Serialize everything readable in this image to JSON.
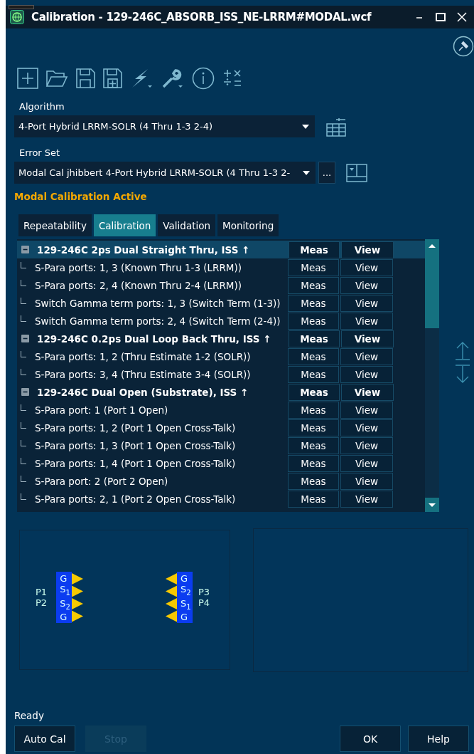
{
  "window": {
    "title": "Calibration - 129-246C_ABSORB_ISS_NE-LRRM#MODAL.wcf"
  },
  "algorithm": {
    "label": "Algorithm",
    "value": "4-Port Hybrid LRRM-SOLR (4 Thru 1-3 2-4)"
  },
  "error_set": {
    "label": "Error Set",
    "value": "Modal Cal jhibbert 4-Port Hybrid LRRM-SOLR (4 Thru 1-3 2-",
    "browse": "..."
  },
  "mode_status": "Modal Calibration Active",
  "tabs": [
    {
      "label": "Repeatability",
      "selected": false
    },
    {
      "label": "Calibration",
      "selected": true
    },
    {
      "label": "Validation",
      "selected": false
    },
    {
      "label": "Monitoring",
      "selected": false
    }
  ],
  "tree": [
    {
      "label": "129-246C 2ps Dual Straight Thru,  ISS ↑",
      "expanded": true,
      "selected": true,
      "meas": "Meas",
      "view": "View",
      "children": [
        {
          "label": "S-Para ports: 1, 3 (Known Thru 1-3 (LRRM))",
          "selected": false,
          "meas": "Meas",
          "view": "View"
        },
        {
          "label": "S-Para ports: 2, 4 (Known Thru 2-4 (LRRM))",
          "selected": false,
          "meas": "Meas",
          "view": "View"
        },
        {
          "label": "Switch Gamma term ports: 1, 3 (Switch Term (1-3))",
          "selected": false,
          "meas": "Meas",
          "view": "View"
        },
        {
          "label": "Switch Gamma term ports: 2, 4 (Switch Term (2-4))",
          "selected": false,
          "meas": "Meas",
          "view": "View"
        }
      ]
    },
    {
      "label": "129-246C 0.2ps Dual Loop Back Thru,  ISS ↑",
      "expanded": true,
      "selected": false,
      "meas": "Meas",
      "view": "View",
      "children": [
        {
          "label": "S-Para ports: 1, 2 (Thru Estimate 1-2 (SOLR))",
          "selected": false,
          "meas": "Meas",
          "view": "View"
        },
        {
          "label": "S-Para ports: 3, 4 (Thru Estimate 3-4 (SOLR))",
          "selected": false,
          "meas": "Meas",
          "view": "View"
        }
      ]
    },
    {
      "label": "129-246C Dual Open (Substrate),  ISS ↑",
      "expanded": true,
      "selected": false,
      "meas": "Meas",
      "view": "View",
      "children": [
        {
          "label": "S-Para port: 1 (Port 1 Open)",
          "selected": false,
          "meas": "Meas",
          "view": "View"
        },
        {
          "label": "S-Para ports: 1, 2 (Port 1 Open Cross-Talk)",
          "selected": false,
          "meas": "Meas",
          "view": "View"
        },
        {
          "label": "S-Para ports: 1, 3 (Port 1 Open Cross-Talk)",
          "selected": false,
          "meas": "Meas",
          "view": "View"
        },
        {
          "label": "S-Para ports: 1, 4 (Port 1 Open Cross-Talk)",
          "selected": false,
          "meas": "Meas",
          "view": "View"
        },
        {
          "label": "S-Para port: 2 (Port 2 Open)",
          "selected": false,
          "meas": "Meas",
          "view": "View"
        },
        {
          "label": "S-Para ports: 2, 1 (Port 2 Open Cross-Talk)",
          "selected": false,
          "meas": "Meas",
          "view": "View"
        }
      ]
    }
  ],
  "probes": [
    {
      "kind": "left",
      "ports": [
        "P1",
        "P2"
      ],
      "pads": [
        "G",
        "S$_{1}$",
        "S$_{2}$",
        "G"
      ]
    },
    {
      "kind": "right",
      "ports": [
        "P3",
        "P4"
      ],
      "pads": [
        "G",
        "S$_{2}$",
        "S$_{1}$",
        "G"
      ]
    }
  ],
  "status_bar": "Ready",
  "buttons": [
    {
      "label": "Auto Cal",
      "disabled": false
    },
    {
      "label": "Stop",
      "disabled": true
    },
    {
      "label": "OK",
      "disabled": false
    },
    {
      "label": "Help",
      "disabled": false
    }
  ]
}
